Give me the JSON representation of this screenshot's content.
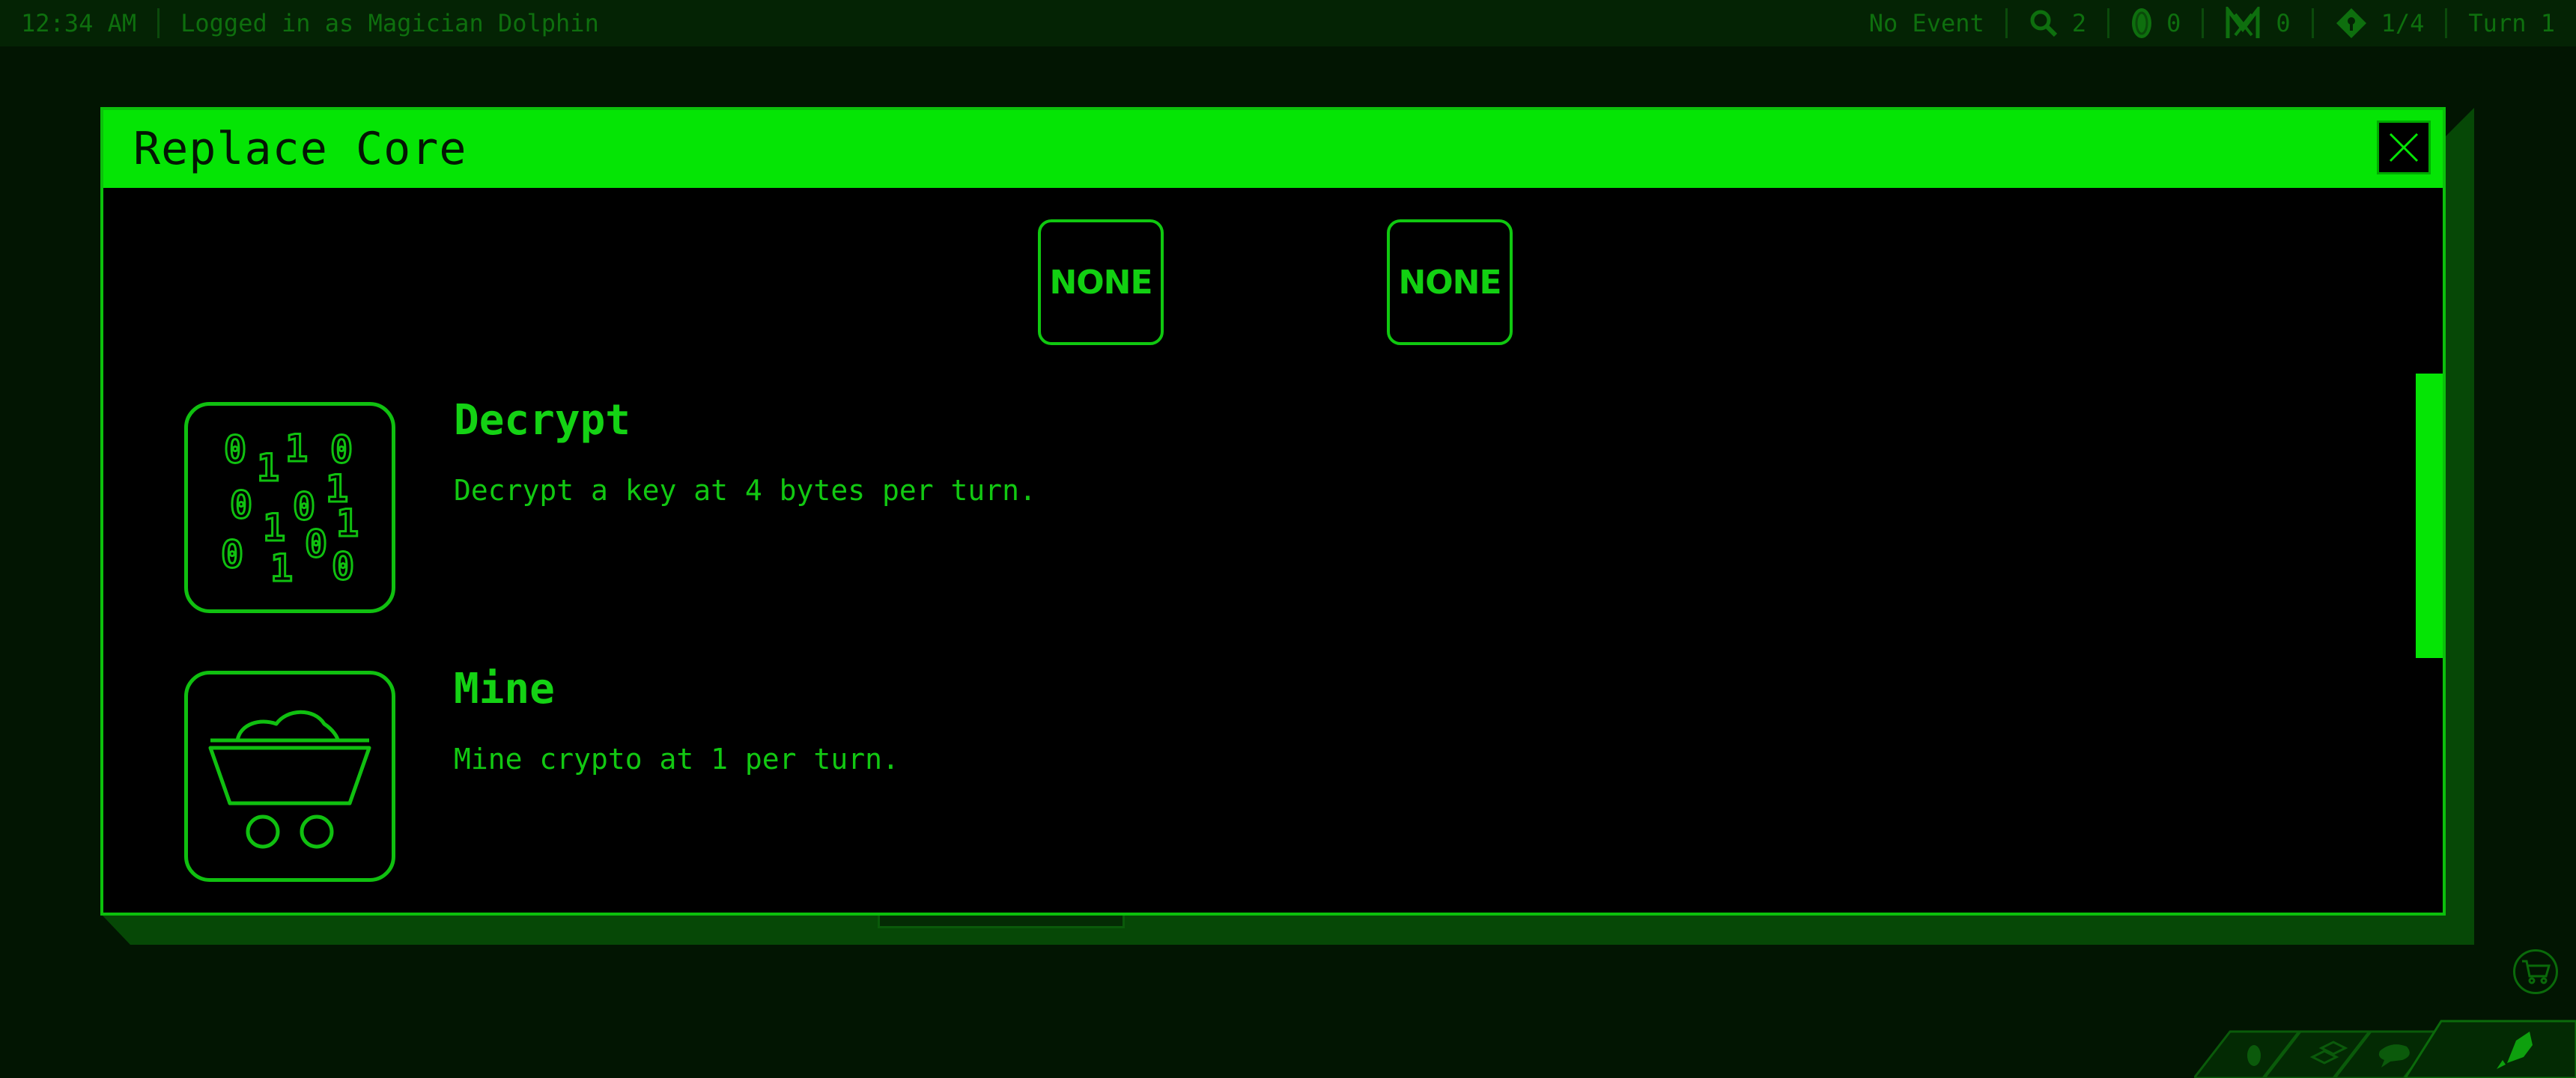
{
  "topbar": {
    "time": "12:34 AM",
    "login": "Logged in as Magician Dolphin",
    "event": "No Event",
    "search_count": "2",
    "coin_count": "0",
    "network_count": "0",
    "keys_count": "1/4",
    "turn": "Turn 1"
  },
  "modal": {
    "title": "Replace Core",
    "slots": [
      "NONE",
      "NONE"
    ],
    "cores": [
      {
        "name": "Decrypt",
        "description": "Decrypt a key at 4 bytes per turn.",
        "icon": "binary-digits-icon"
      },
      {
        "name": "Mine",
        "description": "Mine crypto at 1 per turn.",
        "icon": "mine-cart-icon"
      }
    ]
  },
  "colors": {
    "accent": "#05e505",
    "text": "#12c812",
    "background": "#021502",
    "panel": "#000000"
  }
}
